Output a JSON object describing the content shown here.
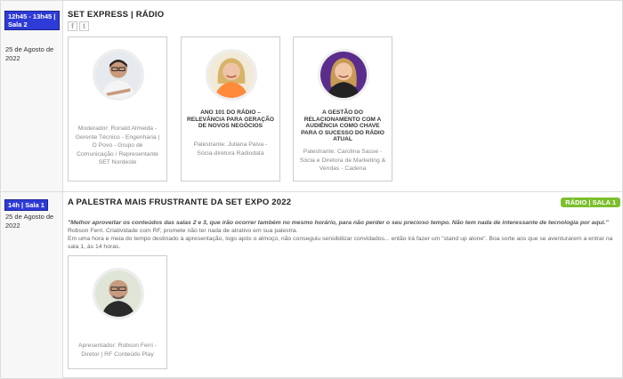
{
  "sessions": [
    {
      "time": "12h45 - 13h45 | Sala 2",
      "date": "25 de Agosto de 2022",
      "title": "SET EXPRESS | RÁDIO",
      "social": {
        "facebook": "f",
        "twitter": "t"
      },
      "cards": [
        {
          "title": "",
          "desc": "Moderador: Ronald Almeida - Gerente Técnico - Engenharia | O Povo - Grupo de Comunicação / Representante SET Nordeste",
          "avatar": "man-glasses"
        },
        {
          "title": "ANO 101 DO RÁDIO – RELEVÂNCIA PARA GERAÇÃO DE NOVOS NEGÓCIOS",
          "desc": "Palestrante: Juliana Paiva - Sócia-diretora Radiodata",
          "avatar": "woman-blonde"
        },
        {
          "title": "A GESTÃO DO RELACIONAMENTO COM A AUDIÊNCIA COMO CHAVE PARA O SUCESSO DO RÁDIO ATUAL",
          "desc": "Palestrante: Carolina Sasse - Sócia e Diretora de Marketing & Vendas - Cadena",
          "avatar": "woman-purple"
        }
      ]
    },
    {
      "time": "14h | Sala 1",
      "date": "25 de Agosto de 2022",
      "title": "A PALESTRA MAIS FRUSTRANTE DA SET EXPO 2022",
      "tag": "RÁDIO | SALA 1",
      "quote": "\"Melhor aproveitar os conteúdos das salas 2 e 3, que irão ocorrer também no mesmo horário, para não perder o seu precioso tempo. Não tem nada de interessante de tecnologia por aqui.\"",
      "line1": "Robson Ferri. Criatividade com RF, promete não ter nada de atrativo em sua palestra.",
      "line2": "Em uma hora e meia do tempo destinado à apresentação, logo após o almoço, não conseguiu sensibilizar convidados... então irá fazer um \"stand up alone\". Boa sorte aos que se aventurarem a entrar na sala 1, às 14 horas.",
      "cards": [
        {
          "title": "",
          "desc": "Apresentador: Robson Ferri - Diretor | RF Conteúdo Play",
          "avatar": "man-bald"
        }
      ]
    }
  ],
  "colors": {
    "time_badge": "#2e3bd6",
    "tag": "#7cbf2e",
    "border": "#cccccc"
  }
}
